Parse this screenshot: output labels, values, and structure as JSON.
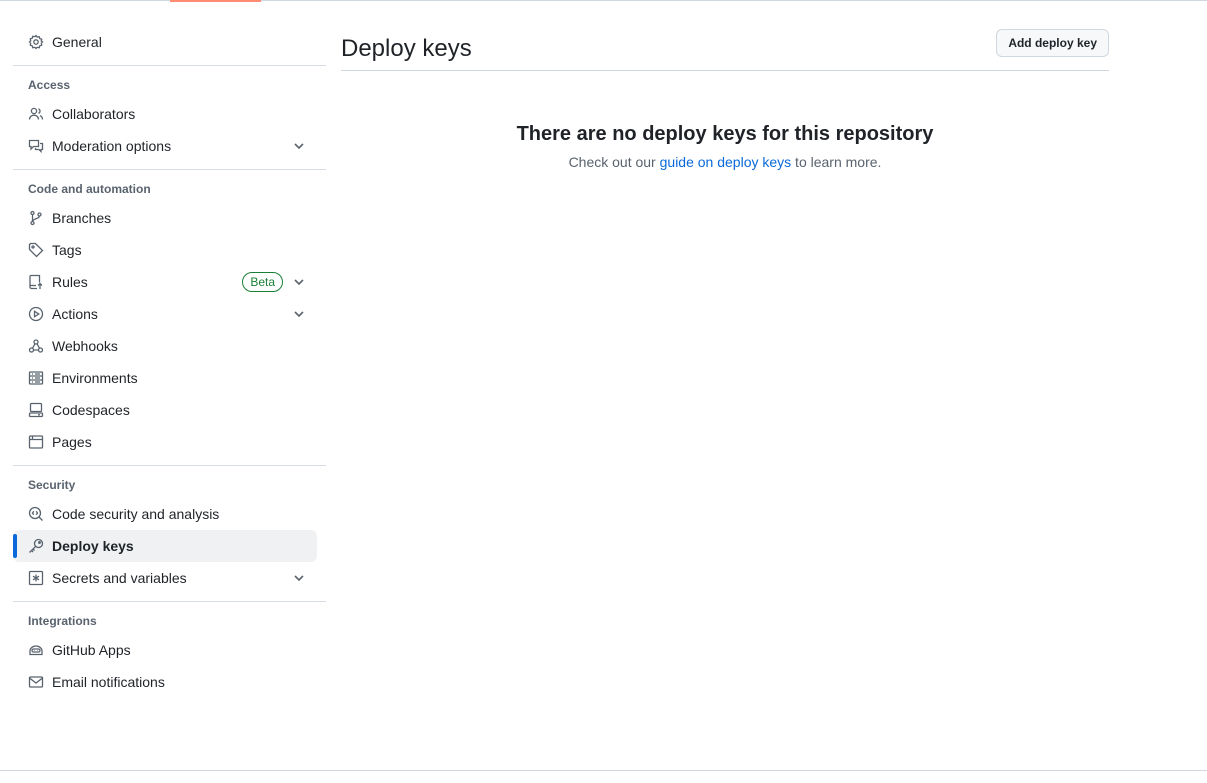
{
  "sidebar": {
    "general": {
      "label": "General",
      "icon": "gear-icon"
    },
    "sections": {
      "access": {
        "heading": "Access",
        "items": [
          {
            "label": "Collaborators",
            "icon": "people-icon"
          },
          {
            "label": "Moderation options",
            "icon": "comment-discussion-icon",
            "expandable": true
          }
        ]
      },
      "code_automation": {
        "heading": "Code and automation",
        "items": [
          {
            "label": "Branches",
            "icon": "git-branch-icon"
          },
          {
            "label": "Tags",
            "icon": "tag-icon"
          },
          {
            "label": "Rules",
            "icon": "repo-push-icon",
            "badge": "Beta",
            "expandable": true
          },
          {
            "label": "Actions",
            "icon": "play-icon",
            "expandable": true
          },
          {
            "label": "Webhooks",
            "icon": "webhook-icon"
          },
          {
            "label": "Environments",
            "icon": "server-icon"
          },
          {
            "label": "Codespaces",
            "icon": "codespaces-icon"
          },
          {
            "label": "Pages",
            "icon": "browser-icon"
          }
        ]
      },
      "security": {
        "heading": "Security",
        "items": [
          {
            "label": "Code security and analysis",
            "icon": "codescan-icon"
          },
          {
            "label": "Deploy keys",
            "icon": "key-icon",
            "active": true
          },
          {
            "label": "Secrets and variables",
            "icon": "key-asterisk-icon",
            "expandable": true
          }
        ]
      },
      "integrations": {
        "heading": "Integrations",
        "items": [
          {
            "label": "GitHub Apps",
            "icon": "hubot-icon"
          },
          {
            "label": "Email notifications",
            "icon": "mail-icon"
          }
        ]
      }
    }
  },
  "main": {
    "title": "Deploy keys",
    "add_button_label": "Add deploy key",
    "blankslate": {
      "title": "There are no deploy keys for this repository",
      "text_before": "Check out our ",
      "link_text": "guide on deploy keys",
      "text_after": " to learn more."
    }
  },
  "colors": {
    "accent": "#0969da",
    "tab_underline": "#fd8c73",
    "beta_green": "#1a7f37"
  }
}
